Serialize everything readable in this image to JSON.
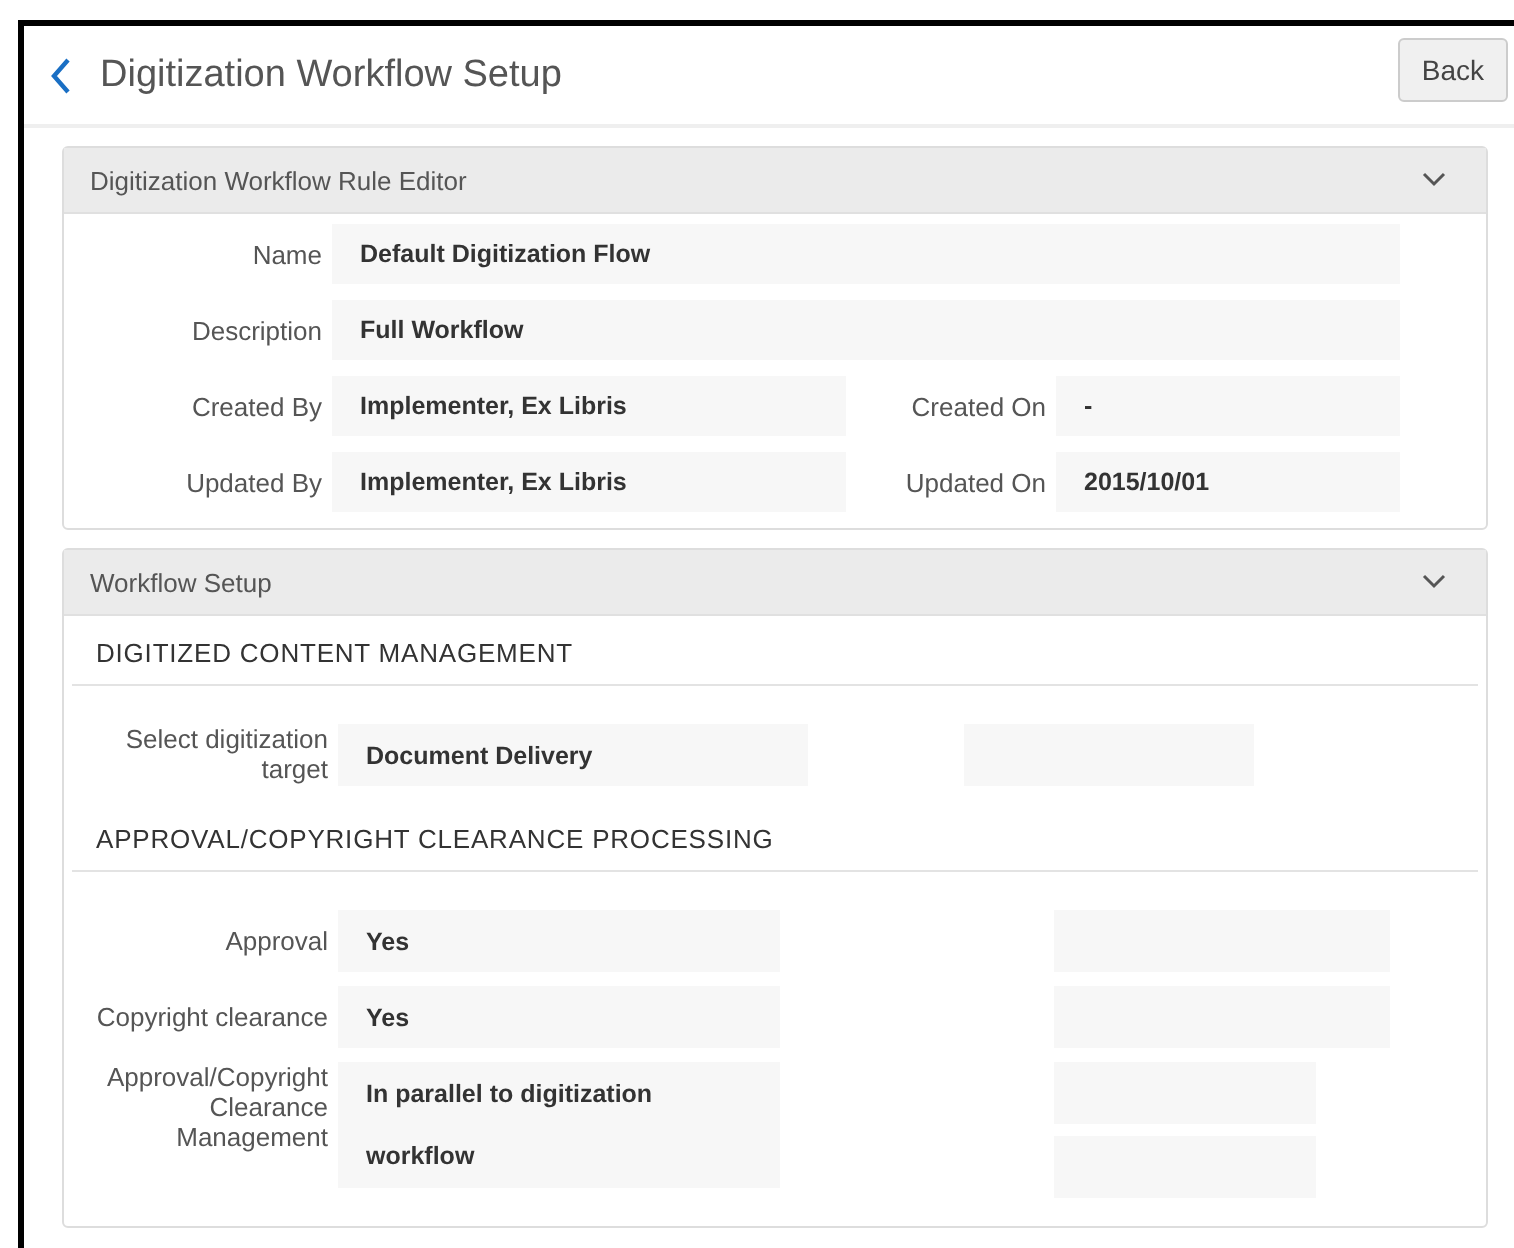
{
  "page": {
    "title": "Digitization Workflow Setup",
    "back_button": "Back"
  },
  "rule_editor": {
    "title": "Digitization Workflow Rule Editor",
    "expanded": true,
    "rows": [
      {
        "cells": [
          {
            "label": "Name",
            "value": "Default Digitization Flow"
          }
        ]
      },
      {
        "cells": [
          {
            "label": "Description",
            "value": "Full Workflow"
          }
        ]
      },
      {
        "cells": [
          {
            "label": "Created By",
            "value": "Implementer, Ex Libris"
          },
          {
            "label": "Created On",
            "value": "-"
          }
        ]
      },
      {
        "cells": [
          {
            "label": "Updated By",
            "value": "Implementer, Ex Libris"
          },
          {
            "label": "Updated On",
            "value": "2015/10/01"
          }
        ]
      }
    ]
  },
  "workflow_setup": {
    "title": "Workflow Setup",
    "expanded": true,
    "sections": [
      {
        "heading": "DIGITIZED CONTENT MANAGEMENT",
        "rows": [
          {
            "kind": "select",
            "label": "Select digitization target",
            "value": "Document Delivery"
          }
        ]
      },
      {
        "heading": "APPROVAL/COPYRIGHT CLEARANCE PROCESSING",
        "rows": [
          {
            "kind": "choice",
            "label": "Approval",
            "value": "Yes"
          },
          {
            "kind": "choice",
            "label": "Copyright clearance",
            "value": "Yes"
          },
          {
            "kind": "multi",
            "label": "Approval/Copyright Clearance Management",
            "value": "In parallel to digitization workflow"
          }
        ]
      }
    ]
  }
}
